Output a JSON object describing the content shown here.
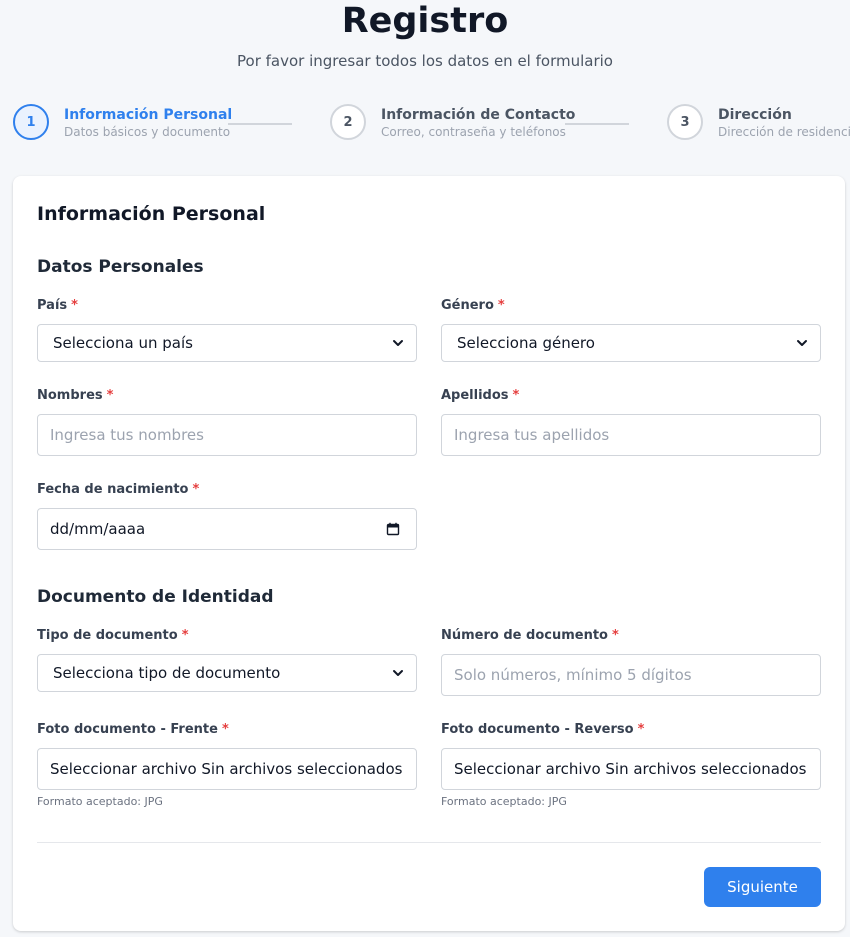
{
  "header": {
    "title": "Registro",
    "subtitle": "Por favor ingresar todos los datos en el formulario"
  },
  "steps": [
    {
      "number": "1",
      "title": "Información Personal",
      "subtitle": "Datos básicos y documento",
      "active": true
    },
    {
      "number": "2",
      "title": "Información de Contacto",
      "subtitle": "Correo, contraseña y teléfonos",
      "active": false
    },
    {
      "number": "3",
      "title": "Dirección",
      "subtitle": "Dirección de residencia",
      "active": false
    }
  ],
  "form": {
    "title": "Información Personal",
    "section_personal": "Datos Personales",
    "section_document": "Documento de Identidad",
    "required_mark": "*",
    "pais": {
      "label": "País",
      "value": "Selecciona un país"
    },
    "genero": {
      "label": "Género",
      "value": "Selecciona género"
    },
    "nombres": {
      "label": "Nombres",
      "placeholder": "Ingresa tus nombres"
    },
    "apellidos": {
      "label": "Apellidos",
      "placeholder": "Ingresa tus apellidos"
    },
    "fecha": {
      "label": "Fecha de nacimiento",
      "value": "dd/mm/aaaa"
    },
    "tipo_documento": {
      "label": "Tipo de documento",
      "value": "Selecciona tipo de documento"
    },
    "numero_documento": {
      "label": "Número de documento",
      "placeholder": "Solo números, mínimo 5 dígitos"
    },
    "foto_frente": {
      "label": "Foto documento - Frente",
      "value": "Seleccionar archivo Sin archivos seleccionados",
      "hint": "Formato aceptado: JPG"
    },
    "foto_reverso": {
      "label": "Foto documento - Reverso",
      "value": "Seleccionar archivo Sin archivos seleccionados",
      "hint": "Formato aceptado: JPG"
    },
    "next_button": "Siguiente"
  },
  "colors": {
    "accent": "#2f80ed",
    "required": "#e53e3e",
    "background": "#f5f7fa"
  },
  "icons": {
    "select_arrow": "chevron-down-icon",
    "date_picker": "calendar-icon"
  }
}
